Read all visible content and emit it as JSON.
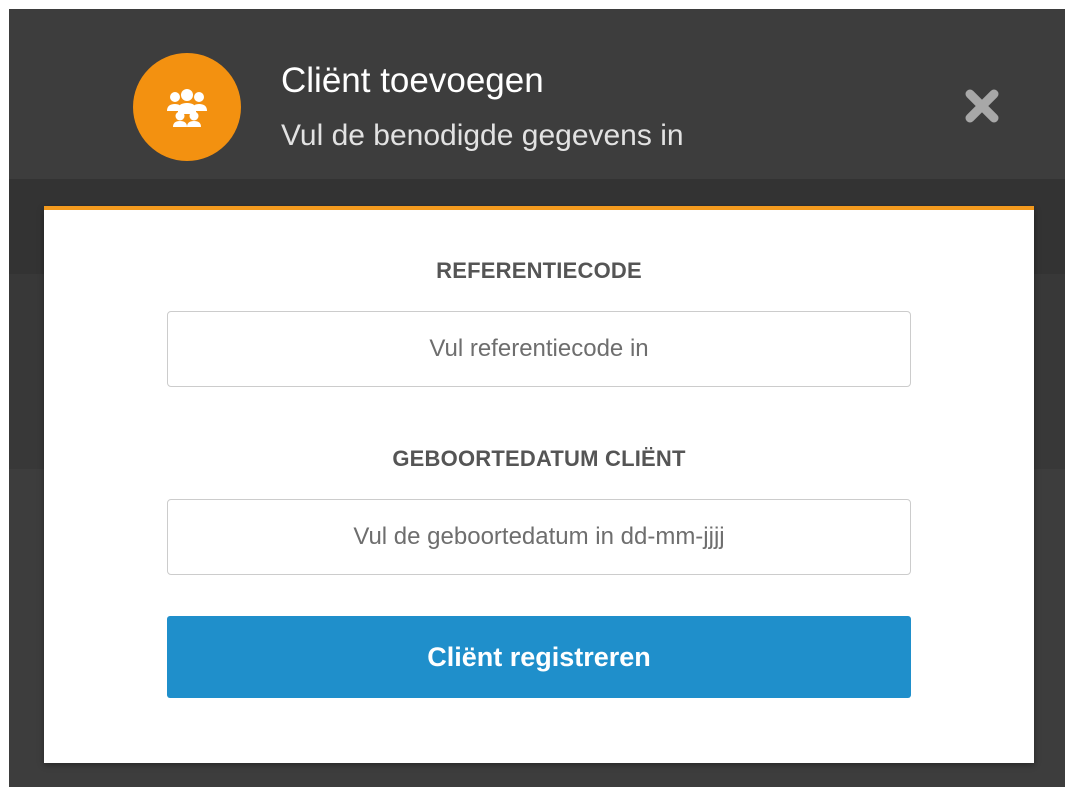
{
  "dialog": {
    "title": "Cliënt toevoegen",
    "subtitle": "Vul de benodigde gegevens in",
    "header_icon": "users-icon",
    "close_icon": "close-icon",
    "accent_color": "#f39110"
  },
  "form": {
    "reference_label": "REFERENTIECODE",
    "reference_placeholder": "Vul referentiecode in",
    "reference_value": "",
    "birthdate_label": "GEBOORTEDATUM CLIËNT",
    "birthdate_placeholder": "Vul de geboortedatum in dd-mm-jjjj",
    "birthdate_value": "",
    "submit_label": "Cliënt registreren",
    "submit_color": "#1f8fcb"
  }
}
